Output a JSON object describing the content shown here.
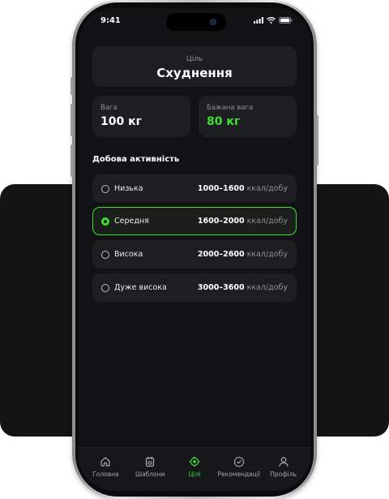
{
  "status": {
    "time": "9:41"
  },
  "goal": {
    "label": "Ціль",
    "value": "Схуднення"
  },
  "weight": {
    "label": "Вага",
    "value": "100 кг"
  },
  "target_weight": {
    "label": "Бажана вага",
    "value": "80 кг"
  },
  "activity": {
    "title": "Добова активність",
    "options": [
      {
        "label": "Низька",
        "range": "1000–1600",
        "unit": "ккал/добу",
        "selected": false
      },
      {
        "label": "Середня",
        "range": "1600–2000",
        "unit": "ккал/добу",
        "selected": true
      },
      {
        "label": "Висока",
        "range": "2000–2600",
        "unit": "ккал/добу",
        "selected": false
      },
      {
        "label": "Дуже висока",
        "range": "3000–3600",
        "unit": "ккал/добу",
        "selected": false
      }
    ]
  },
  "tabs": [
    {
      "label": "Головна",
      "icon": "home-icon",
      "active": false
    },
    {
      "label": "Шаблони",
      "icon": "calendar-icon",
      "active": false
    },
    {
      "label": "Цілі",
      "icon": "target-icon",
      "active": true
    },
    {
      "label": "Рекомендації",
      "icon": "badge-check-icon",
      "active": false
    },
    {
      "label": "Профіль",
      "icon": "user-icon",
      "active": false
    }
  ],
  "colors": {
    "accent": "#3ee02f",
    "background": "#101214",
    "card": "#1c1e21"
  }
}
